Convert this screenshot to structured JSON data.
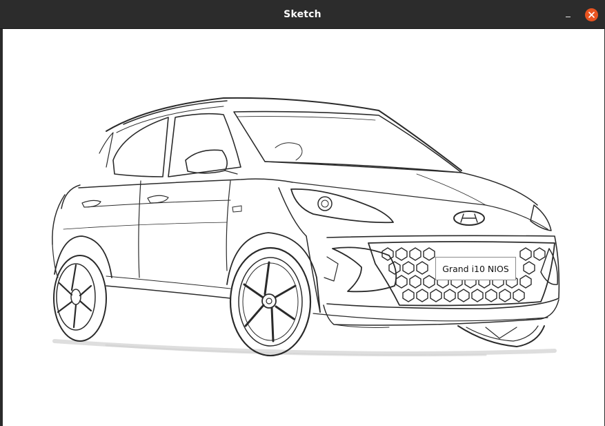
{
  "window": {
    "title": "Sketch",
    "minimize_icon": "minimize-icon",
    "close_icon": "close-icon",
    "close_color": "#e95420"
  },
  "canvas": {
    "subject": "car-line-sketch",
    "license_plate_text": "Grand i10 NIOS",
    "background": "#ffffff",
    "stroke_color": "#2a2a2a"
  }
}
